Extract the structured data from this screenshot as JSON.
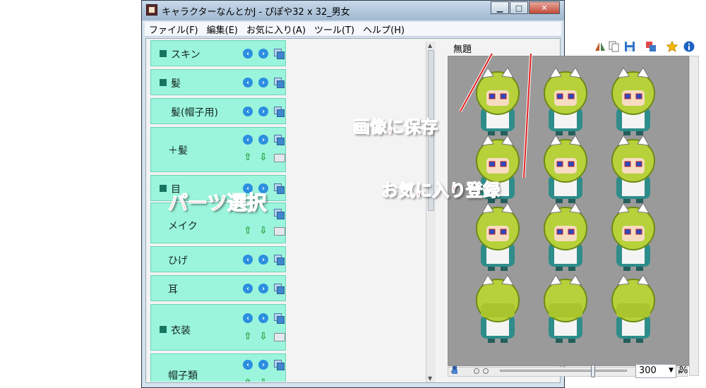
{
  "window": {
    "title": "キャラクターなんとかJ - ぴぽや32 x 32_男女",
    "minimize_label": "▁",
    "maximize_label": "□",
    "close_label": "✕"
  },
  "menu": [
    "ファイル(F)",
    "編集(E)",
    "お気に入り(A)",
    "ツール(T)",
    "ヘルプ(H)"
  ],
  "parts": [
    {
      "label": "スキン"
    },
    {
      "label": "髪"
    },
    {
      "label": "髪(帽子用)"
    },
    {
      "label": "＋髪"
    },
    {
      "label": "目"
    },
    {
      "label": "メイク"
    },
    {
      "label": "ひげ"
    },
    {
      "label": "耳"
    },
    {
      "label": "衣装"
    },
    {
      "label": "帽子類"
    }
  ],
  "preview": {
    "doc_title": "無題"
  },
  "status": {
    "zoom_value": "300",
    "zoom_unit": "%"
  },
  "annotations": {
    "save_image": "画像に保存",
    "add_favorite": "お気に入り登録",
    "parts_select": "パーツ選択"
  },
  "colors": {
    "parts_bg": "#9bf5dc",
    "accent_blue": "#2b8ee0",
    "annotation_red": "#e01e1e"
  }
}
